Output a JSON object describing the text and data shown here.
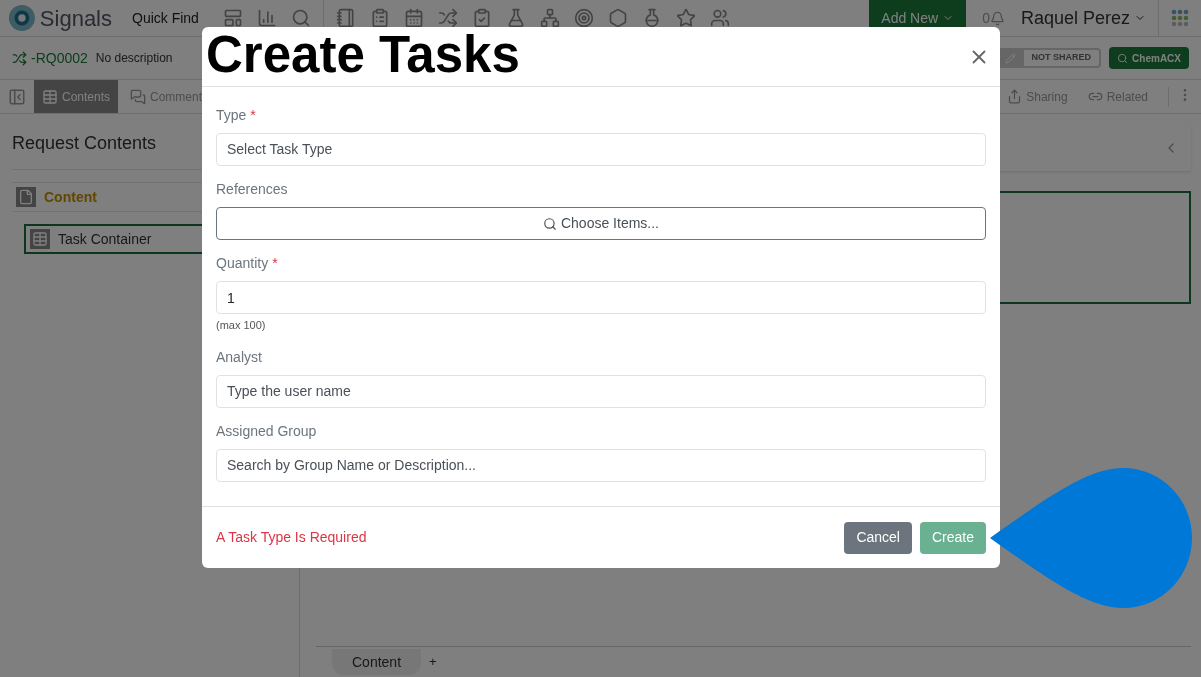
{
  "top_bar": {
    "logo": "Signals",
    "quick_find": "Quick Find",
    "add_new": "Add New",
    "notification_count": "0",
    "user": "Raquel Perez"
  },
  "record_bar": {
    "id": "-RQ0002",
    "description": "No description",
    "share_status": "NOT SHARED",
    "chem_button": "ChemACX"
  },
  "tabs": [
    {
      "label": "Contents",
      "selected": true
    },
    {
      "label": "Comment",
      "selected": false
    }
  ],
  "actions": [
    "Sharing",
    "Related"
  ],
  "sidebar": {
    "title": "Request Contents",
    "items": [
      {
        "label": "Content",
        "selected": false,
        "children": [
          {
            "label": "Task Container",
            "selected": true
          }
        ]
      }
    ]
  },
  "bottom_tabs": {
    "label": "Content",
    "add": "+"
  },
  "dialog": {
    "title": "Create Tasks",
    "fields": [
      {
        "kind": "select",
        "label": "Type",
        "required_mark": "*",
        "placeholder": "Select Task Type"
      },
      {
        "kind": "button",
        "label": "References",
        "value": "Choose Items..."
      },
      {
        "kind": "input",
        "label": "Quantity",
        "required_mark": "*",
        "value": "1",
        "hint": "(max 100)"
      },
      {
        "kind": "input",
        "label": "Analyst",
        "placeholder": "Type the user name"
      },
      {
        "kind": "input",
        "label": "Assigned Group",
        "placeholder": "Search by Group Name or Description..."
      }
    ],
    "error": "A Task Type Is Required",
    "cancel": "Cancel",
    "create": {
      "label": "Create",
      "disabled": true
    }
  }
}
